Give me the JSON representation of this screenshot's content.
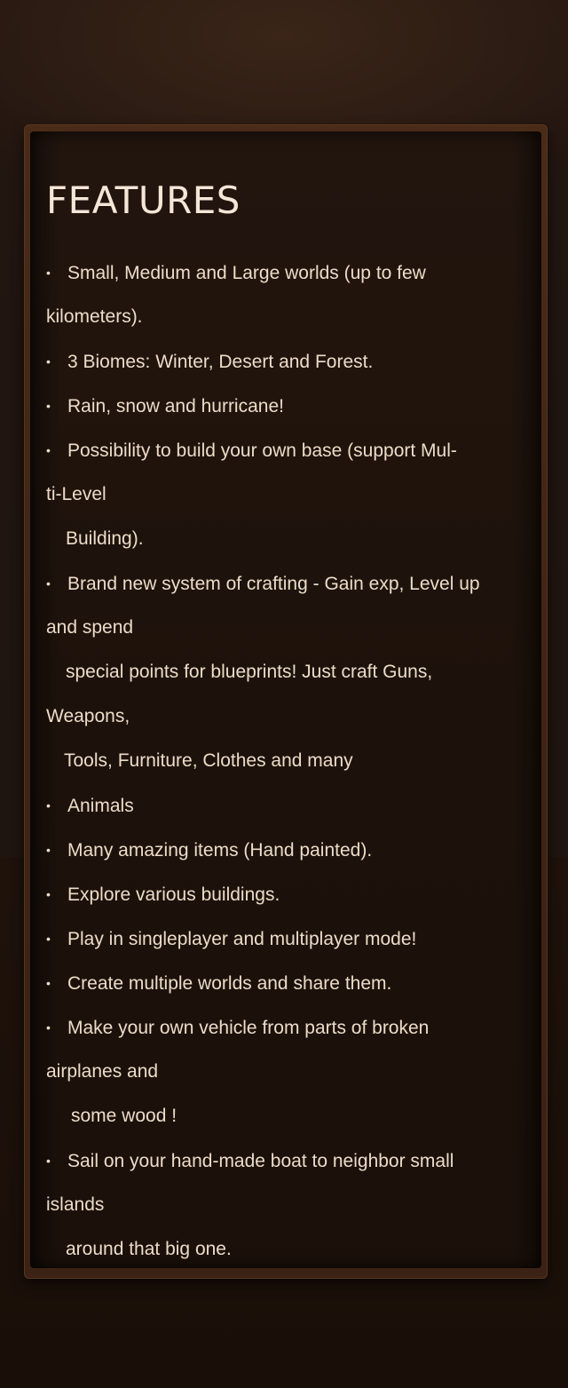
{
  "section": {
    "title": "FEATURES"
  },
  "features": [
    "Small, Medium and Large worlds (up to few",
    "kilometers).",
    "3 Biomes: Winter, Desert and Forest.",
    "Rain, snow and hurricane!",
    "Possibility to build your own base (support Mul-",
    "ti-Level",
    "Building).",
    "Brand new system of crafting - Gain exp, Level up",
    "and spend",
    "special points for blueprints! Just craft Guns,",
    "Weapons,",
    "Tools, Furniture, Clothes and many",
    "Animals",
    "Many amazing items (Hand painted).",
    "Explore various buildings.",
    "Play in singleplayer and multiplayer mode!",
    "Create multiple worlds and share them.",
    "Make your own vehicle from parts of broken",
    "airplanes and",
    "some wood !",
    "Sail on your hand-made boat to neighbor small",
    "islands",
    "around that big one."
  ],
  "bullet_glyph": "•",
  "colors": {
    "title": "#f4e7d8",
    "text": "#ecdcc8",
    "frame": "#4a2b18",
    "panel": "#1d120b"
  }
}
